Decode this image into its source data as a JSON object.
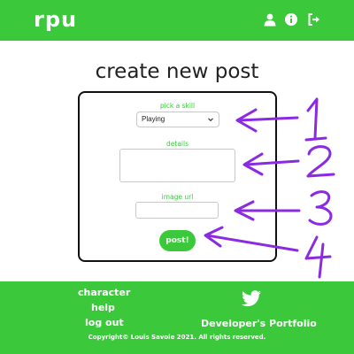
{
  "app": {
    "logo": "rpu",
    "header_icons": [
      "user-icon",
      "info-icon",
      "sign-out-icon"
    ]
  },
  "page": {
    "title": "create new post"
  },
  "form": {
    "skill_label": "pick a skill",
    "skill_selected": "Playing",
    "details_label": "details",
    "details_value": "",
    "image_url_label": "image url",
    "image_url_value": "",
    "submit_label": "post!"
  },
  "annotations": {
    "numbers": [
      "1",
      "2",
      "3",
      "4"
    ],
    "color": "#8a2be2"
  },
  "footer": {
    "links": [
      "character",
      "help",
      "log out"
    ],
    "portfolio_label": "Developer's Portfolio",
    "social_icon": "twitter-icon",
    "copyright": "Copyright© Louis Savoie 2021. All rights reserved."
  },
  "colors": {
    "brand_green": "#3bc93b",
    "text_dark": "#222222",
    "white": "#ffffff"
  }
}
